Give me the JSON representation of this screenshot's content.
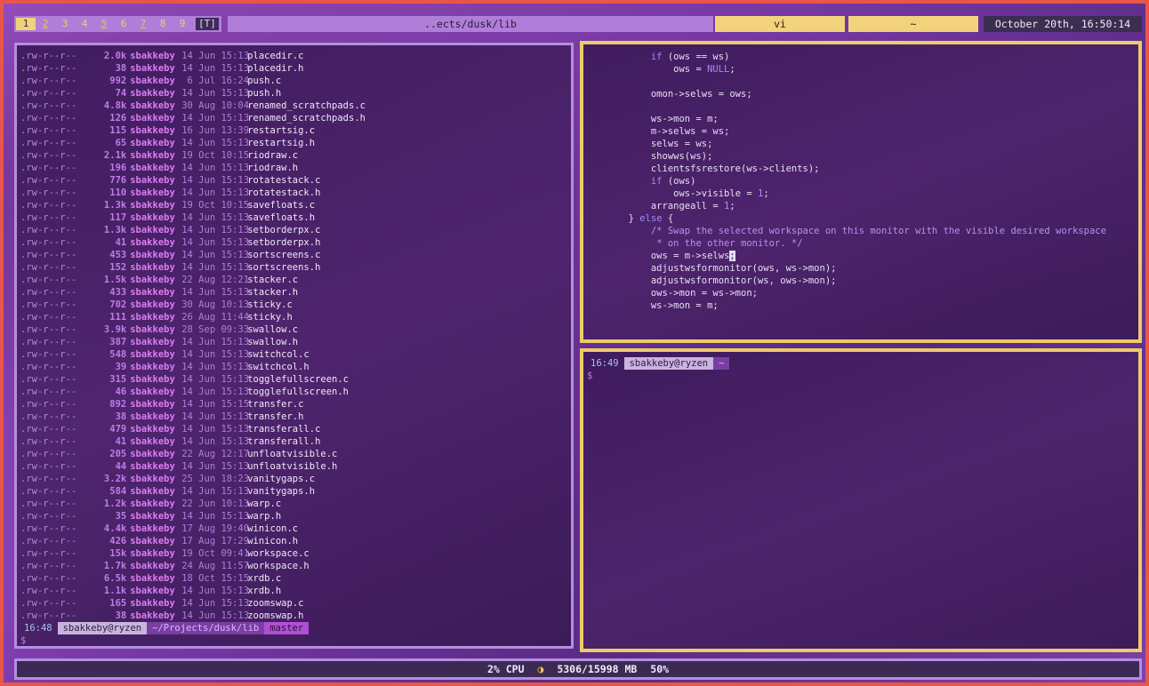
{
  "statusbar": {
    "tags": [
      "1",
      "2",
      "3",
      "4",
      "5",
      "6",
      "7",
      "8",
      "9"
    ],
    "layout": "[T]",
    "window_title": "..ects/dusk/lib",
    "seg_vi": "vi",
    "seg_home": "~",
    "datetime": "October 20th, 16:50:14",
    "colors": {
      "selected_tag": "#f0d278",
      "bar": "#b07ed8",
      "clock_bg": "#3c2d52",
      "accent": "#eccb6a"
    }
  },
  "listing": {
    "rows": [
      {
        "perm": ".rw-r--r--",
        "size": "2.0k",
        "user": "sbakkeby",
        "date": "14 Jun 15:13",
        "name": "placedir.c"
      },
      {
        "perm": ".rw-r--r--",
        "size": "38",
        "user": "sbakkeby",
        "date": "14 Jun 15:13",
        "name": "placedir.h"
      },
      {
        "perm": ".rw-r--r--",
        "size": "992",
        "user": "sbakkeby",
        "date": " 6 Jul 16:24",
        "name": "push.c"
      },
      {
        "perm": ".rw-r--r--",
        "size": "74",
        "user": "sbakkeby",
        "date": "14 Jun 15:13",
        "name": "push.h"
      },
      {
        "perm": ".rw-r--r--",
        "size": "4.8k",
        "user": "sbakkeby",
        "date": "30 Aug 10:04",
        "name": "renamed_scratchpads.c"
      },
      {
        "perm": ".rw-r--r--",
        "size": "126",
        "user": "sbakkeby",
        "date": "14 Jun 15:13",
        "name": "renamed_scratchpads.h"
      },
      {
        "perm": ".rw-r--r--",
        "size": "115",
        "user": "sbakkeby",
        "date": "16 Jun 13:39",
        "name": "restartsig.c"
      },
      {
        "perm": ".rw-r--r--",
        "size": "65",
        "user": "sbakkeby",
        "date": "14 Jun 15:13",
        "name": "restartsig.h"
      },
      {
        "perm": ".rw-r--r--",
        "size": "2.1k",
        "user": "sbakkeby",
        "date": "19 Oct 10:15",
        "name": "riodraw.c"
      },
      {
        "perm": ".rw-r--r--",
        "size": "196",
        "user": "sbakkeby",
        "date": "14 Jun 15:13",
        "name": "riodraw.h"
      },
      {
        "perm": ".rw-r--r--",
        "size": "776",
        "user": "sbakkeby",
        "date": "14 Jun 15:13",
        "name": "rotatestack.c"
      },
      {
        "perm": ".rw-r--r--",
        "size": "110",
        "user": "sbakkeby",
        "date": "14 Jun 15:13",
        "name": "rotatestack.h"
      },
      {
        "perm": ".rw-r--r--",
        "size": "1.3k",
        "user": "sbakkeby",
        "date": "19 Oct 10:15",
        "name": "savefloats.c"
      },
      {
        "perm": ".rw-r--r--",
        "size": "117",
        "user": "sbakkeby",
        "date": "14 Jun 15:13",
        "name": "savefloats.h"
      },
      {
        "perm": ".rw-r--r--",
        "size": "1.3k",
        "user": "sbakkeby",
        "date": "14 Jun 15:13",
        "name": "setborderpx.c"
      },
      {
        "perm": ".rw-r--r--",
        "size": "41",
        "user": "sbakkeby",
        "date": "14 Jun 15:13",
        "name": "setborderpx.h"
      },
      {
        "perm": ".rw-r--r--",
        "size": "453",
        "user": "sbakkeby",
        "date": "14 Jun 15:13",
        "name": "sortscreens.c"
      },
      {
        "perm": ".rw-r--r--",
        "size": "152",
        "user": "sbakkeby",
        "date": "14 Jun 15:13",
        "name": "sortscreens.h"
      },
      {
        "perm": ".rw-r--r--",
        "size": "1.5k",
        "user": "sbakkeby",
        "date": "22 Aug 12:21",
        "name": "stacker.c"
      },
      {
        "perm": ".rw-r--r--",
        "size": "433",
        "user": "sbakkeby",
        "date": "14 Jun 15:13",
        "name": "stacker.h"
      },
      {
        "perm": ".rw-r--r--",
        "size": "702",
        "user": "sbakkeby",
        "date": "30 Aug 10:13",
        "name": "sticky.c"
      },
      {
        "perm": ".rw-r--r--",
        "size": "111",
        "user": "sbakkeby",
        "date": "26 Aug 11:44",
        "name": "sticky.h"
      },
      {
        "perm": ".rw-r--r--",
        "size": "3.9k",
        "user": "sbakkeby",
        "date": "28 Sep 09:33",
        "name": "swallow.c"
      },
      {
        "perm": ".rw-r--r--",
        "size": "387",
        "user": "sbakkeby",
        "date": "14 Jun 15:13",
        "name": "swallow.h"
      },
      {
        "perm": ".rw-r--r--",
        "size": "548",
        "user": "sbakkeby",
        "date": "14 Jun 15:13",
        "name": "switchcol.c"
      },
      {
        "perm": ".rw-r--r--",
        "size": "39",
        "user": "sbakkeby",
        "date": "14 Jun 15:13",
        "name": "switchcol.h"
      },
      {
        "perm": ".rw-r--r--",
        "size": "315",
        "user": "sbakkeby",
        "date": "14 Jun 15:13",
        "name": "togglefullscreen.c"
      },
      {
        "perm": ".rw-r--r--",
        "size": "46",
        "user": "sbakkeby",
        "date": "14 Jun 15:13",
        "name": "togglefullscreen.h"
      },
      {
        "perm": ".rw-r--r--",
        "size": "892",
        "user": "sbakkeby",
        "date": "14 Jun 15:15",
        "name": "transfer.c"
      },
      {
        "perm": ".rw-r--r--",
        "size": "38",
        "user": "sbakkeby",
        "date": "14 Jun 15:13",
        "name": "transfer.h"
      },
      {
        "perm": ".rw-r--r--",
        "size": "479",
        "user": "sbakkeby",
        "date": "14 Jun 15:13",
        "name": "transferall.c"
      },
      {
        "perm": ".rw-r--r--",
        "size": "41",
        "user": "sbakkeby",
        "date": "14 Jun 15:13",
        "name": "transferall.h"
      },
      {
        "perm": ".rw-r--r--",
        "size": "205",
        "user": "sbakkeby",
        "date": "22 Aug 12:17",
        "name": "unfloatvisible.c"
      },
      {
        "perm": ".rw-r--r--",
        "size": "44",
        "user": "sbakkeby",
        "date": "14 Jun 15:13",
        "name": "unfloatvisible.h"
      },
      {
        "perm": ".rw-r--r--",
        "size": "3.2k",
        "user": "sbakkeby",
        "date": "25 Jun 18:23",
        "name": "vanitygaps.c"
      },
      {
        "perm": ".rw-r--r--",
        "size": "584",
        "user": "sbakkeby",
        "date": "14 Jun 15:13",
        "name": "vanitygaps.h"
      },
      {
        "perm": ".rw-r--r--",
        "size": "1.2k",
        "user": "sbakkeby",
        "date": "22 Jun 10:13",
        "name": "warp.c"
      },
      {
        "perm": ".rw-r--r--",
        "size": "35",
        "user": "sbakkeby",
        "date": "14 Jun 15:13",
        "name": "warp.h"
      },
      {
        "perm": ".rw-r--r--",
        "size": "4.4k",
        "user": "sbakkeby",
        "date": "17 Aug 19:40",
        "name": "winicon.c"
      },
      {
        "perm": ".rw-r--r--",
        "size": "426",
        "user": "sbakkeby",
        "date": "17 Aug 17:29",
        "name": "winicon.h"
      },
      {
        "perm": ".rw-r--r--",
        "size": "15k",
        "user": "sbakkeby",
        "date": "19 Oct 09:41",
        "name": "workspace.c"
      },
      {
        "perm": ".rw-r--r--",
        "size": "1.7k",
        "user": "sbakkeby",
        "date": "24 Aug 11:57",
        "name": "workspace.h"
      },
      {
        "perm": ".rw-r--r--",
        "size": "6.5k",
        "user": "sbakkeby",
        "date": "18 Oct 15:15",
        "name": "xrdb.c"
      },
      {
        "perm": ".rw-r--r--",
        "size": "1.1k",
        "user": "sbakkeby",
        "date": "14 Jun 15:13",
        "name": "xrdb.h"
      },
      {
        "perm": ".rw-r--r--",
        "size": "165",
        "user": "sbakkeby",
        "date": "14 Jun 15:13",
        "name": "zoomswap.c"
      },
      {
        "perm": ".rw-r--r--",
        "size": "38",
        "user": "sbakkeby",
        "date": "14 Jun 15:13",
        "name": "zoomswap.h"
      }
    ],
    "prompt": {
      "time": "16:48",
      "user_host": "sbakkeby@ryzen",
      "path": "~/Projects/dusk/lib",
      "git": "master",
      "symbol": "$"
    }
  },
  "editor": {
    "lines": [
      {
        "indent": "            ",
        "parts": [
          {
            "t": "if",
            "c": "kw"
          },
          {
            "t": " (ows == ws)",
            "c": ""
          }
        ]
      },
      {
        "indent": "                ",
        "parts": [
          {
            "t": "ows = ",
            "c": ""
          },
          {
            "t": "NULL",
            "c": "kw"
          },
          {
            "t": ";",
            "c": ""
          }
        ]
      },
      {
        "indent": "",
        "parts": []
      },
      {
        "indent": "            ",
        "parts": [
          {
            "t": "omon->selws = ows;",
            "c": ""
          }
        ]
      },
      {
        "indent": "",
        "parts": []
      },
      {
        "indent": "            ",
        "parts": [
          {
            "t": "ws->mon = m;",
            "c": ""
          }
        ]
      },
      {
        "indent": "            ",
        "parts": [
          {
            "t": "m->selws = ws;",
            "c": ""
          }
        ]
      },
      {
        "indent": "            ",
        "parts": [
          {
            "t": "selws = ws;",
            "c": ""
          }
        ]
      },
      {
        "indent": "            ",
        "parts": [
          {
            "t": "showws(ws);",
            "c": ""
          }
        ]
      },
      {
        "indent": "            ",
        "parts": [
          {
            "t": "clientsfsrestore(ws->clients);",
            "c": ""
          }
        ]
      },
      {
        "indent": "            ",
        "parts": [
          {
            "t": "if",
            "c": "kw"
          },
          {
            "t": " (ows)",
            "c": ""
          }
        ]
      },
      {
        "indent": "                ",
        "parts": [
          {
            "t": "ows->visible = ",
            "c": ""
          },
          {
            "t": "1",
            "c": "num"
          },
          {
            "t": ";",
            "c": ""
          }
        ]
      },
      {
        "indent": "            ",
        "parts": [
          {
            "t": "arrangeall = ",
            "c": ""
          },
          {
            "t": "1",
            "c": "num"
          },
          {
            "t": ";",
            "c": ""
          }
        ]
      },
      {
        "indent": "        ",
        "parts": [
          {
            "t": "} ",
            "c": ""
          },
          {
            "t": "else",
            "c": "kw"
          },
          {
            "t": " {",
            "c": ""
          }
        ]
      },
      {
        "indent": "            ",
        "parts": [
          {
            "t": "/* Swap the selected workspace on this monitor with the visible desired workspace",
            "c": "cm"
          }
        ]
      },
      {
        "indent": "             ",
        "parts": [
          {
            "t": "* on the other monitor. */",
            "c": "cm"
          }
        ]
      },
      {
        "indent": "            ",
        "parts": [
          {
            "t": "ows = m->selws",
            "c": ""
          },
          {
            "t": ";",
            "c": "cursor"
          }
        ]
      },
      {
        "indent": "            ",
        "parts": [
          {
            "t": "adjustwsformonitor(ows, ws->mon);",
            "c": ""
          }
        ]
      },
      {
        "indent": "            ",
        "parts": [
          {
            "t": "adjustwsformonitor(ws, ows->mon);",
            "c": ""
          }
        ]
      },
      {
        "indent": "            ",
        "parts": [
          {
            "t": "ows->mon = ws->mon;",
            "c": ""
          }
        ]
      },
      {
        "indent": "            ",
        "parts": [
          {
            "t": "ws->mon = m;",
            "c": ""
          }
        ]
      }
    ]
  },
  "terminal": {
    "prompt": {
      "time": "16:49",
      "user_host": "sbakkeby@ryzen",
      "path": "~",
      "symbol": "$"
    }
  },
  "bottombar": {
    "cpu": "2% CPU",
    "mem_icon": "moon-icon",
    "mem": "5306/15998 MB",
    "pct": "50%"
  }
}
